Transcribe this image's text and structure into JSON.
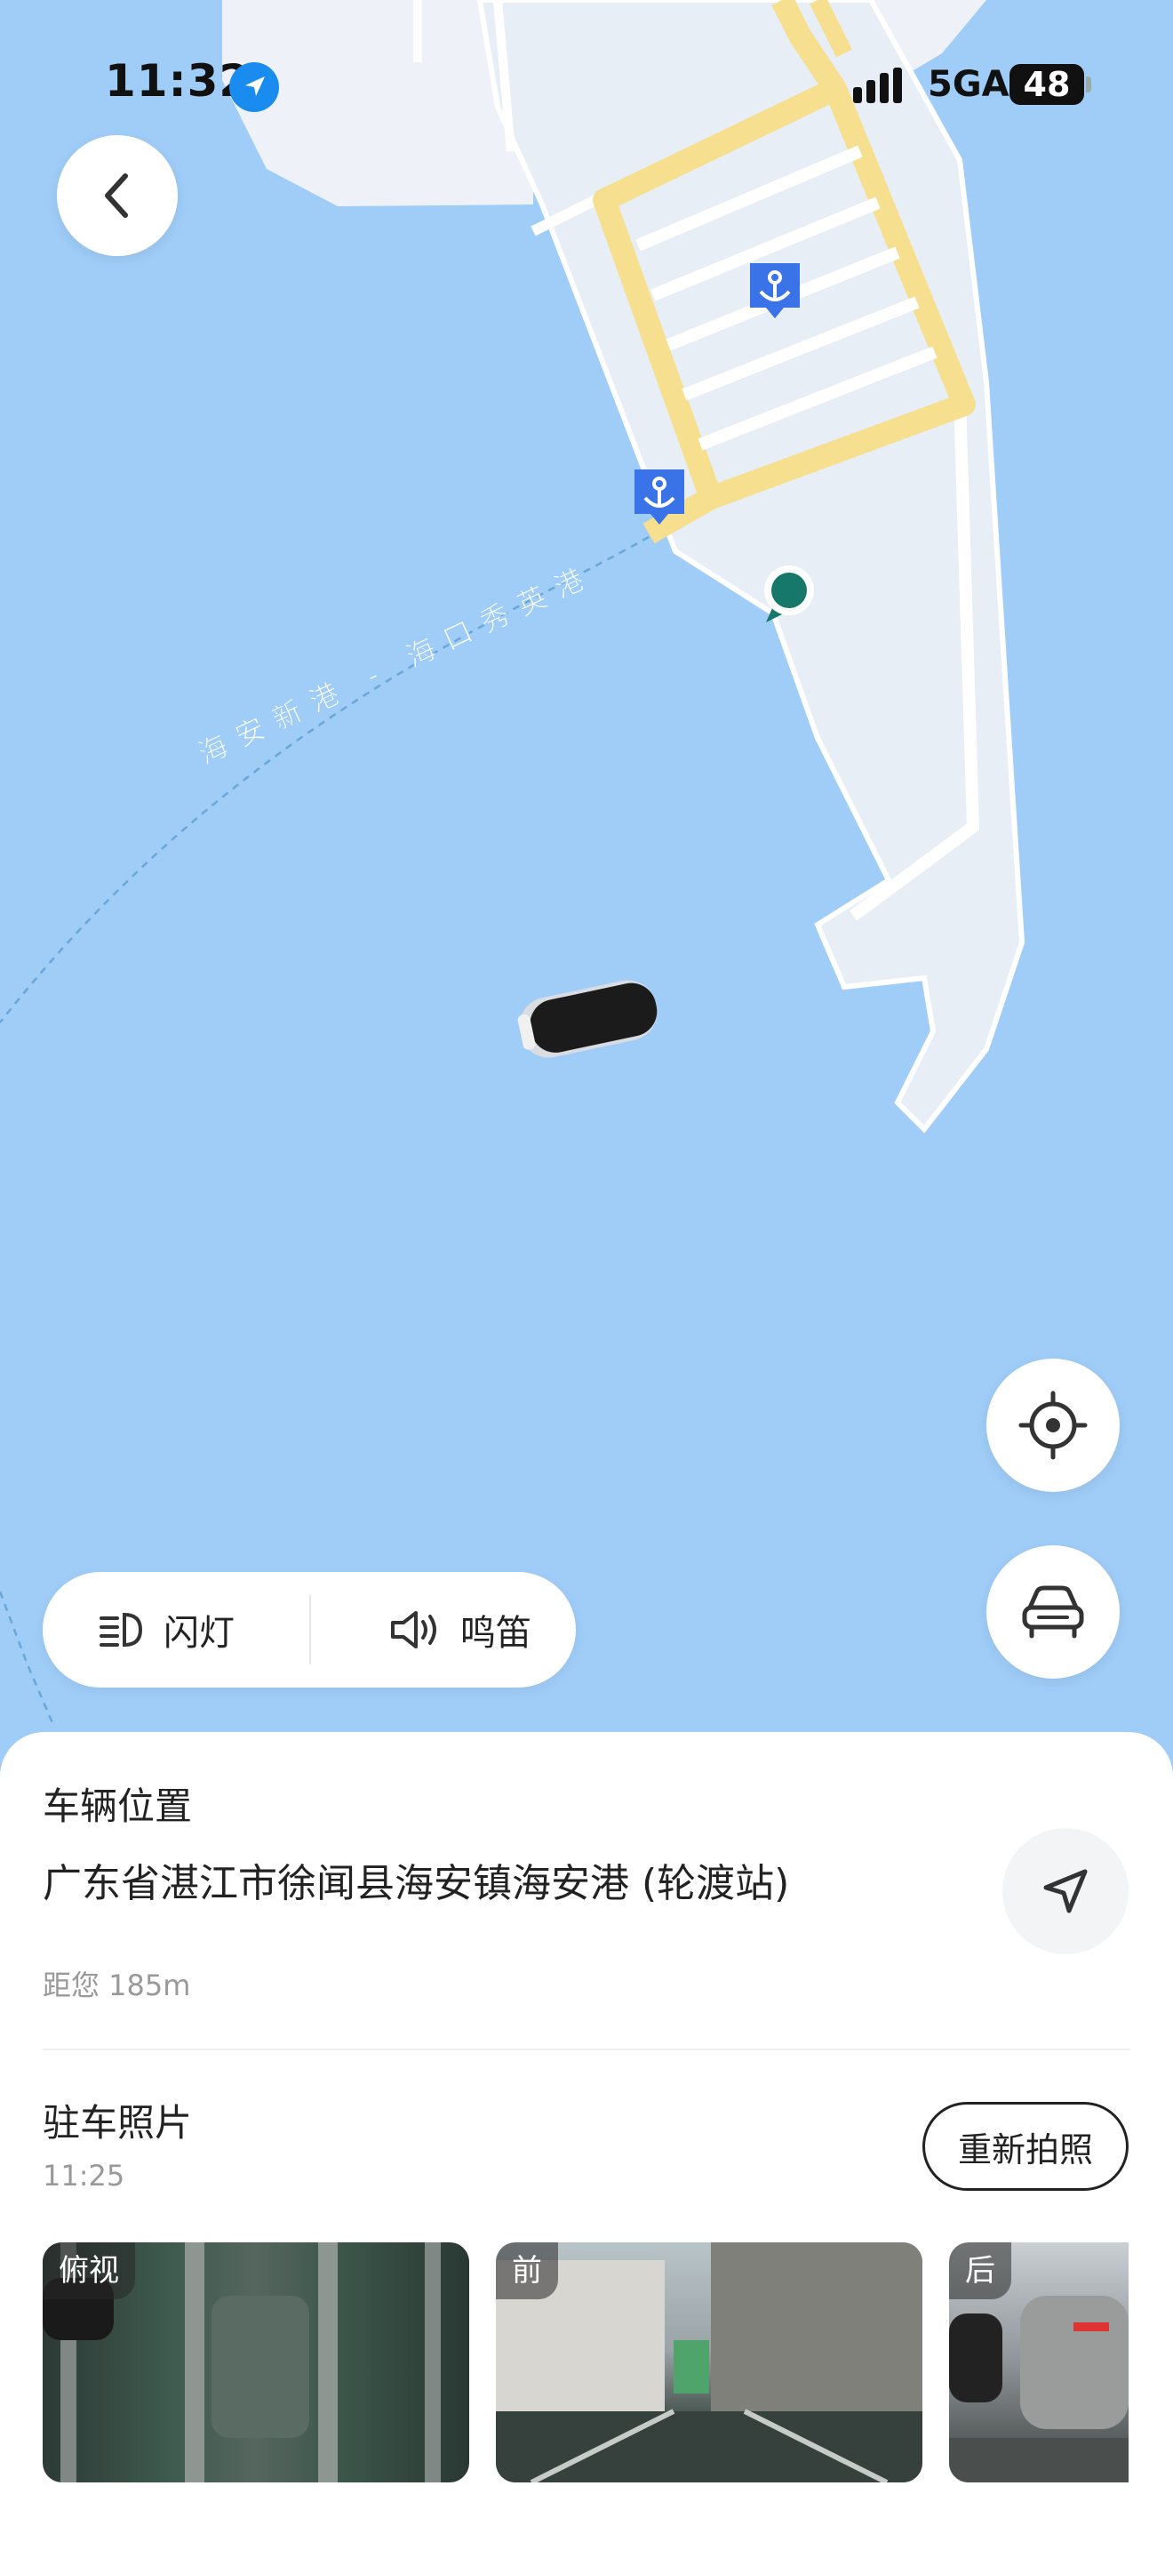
{
  "status_bar": {
    "time": "11:32",
    "network": "5GA",
    "battery": "48"
  },
  "map": {
    "route_label": "海安新港 - 海口秀英港",
    "colors": {
      "water": "#9fcdf8",
      "land": "#e8eef6",
      "road": "#f6df8e",
      "pin": "#3a72e8",
      "marker": "#15786a"
    }
  },
  "controls": {
    "back_icon": "chevron-left-icon",
    "locate_icon": "crosshair-icon",
    "vehicle_icon": "car-front-icon",
    "flash_label": "闪灯",
    "horn_label": "鸣笛"
  },
  "sheet": {
    "vehicle_location_title": "车辆位置",
    "address": "广东省湛江市徐闻县海安镇海安港 (轮渡站)",
    "distance": "距您 185m",
    "parking_photos_title": "驻车照片",
    "photo_time": "11:25",
    "retake_label": "重新拍照",
    "photos": [
      {
        "label": "俯视"
      },
      {
        "label": "前"
      },
      {
        "label": "后"
      }
    ]
  }
}
